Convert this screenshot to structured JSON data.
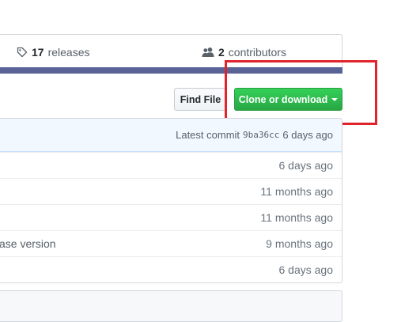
{
  "stats": {
    "releases_count": "17",
    "releases_label": "releases",
    "contributors_count": "2",
    "contributors_label": "contributors"
  },
  "toolbar": {
    "find_file_label": "Find File",
    "clone_label": "Clone or download"
  },
  "latest_commit": {
    "prefix": "Latest commit",
    "sha": "9ba36cc",
    "age": "6 days ago"
  },
  "files": [
    {
      "message": "",
      "age": "6 days ago"
    },
    {
      "message": "",
      "age": "11 months ago"
    },
    {
      "message": "",
      "age": "11 months ago"
    },
    {
      "message": "ase version",
      "age": "9 months ago"
    },
    {
      "message": "",
      "age": "6 days ago"
    }
  ],
  "colors": {
    "language_bar": "#5a6396",
    "clone_button": "#2ea44f",
    "highlight_box": "#e0242b"
  }
}
